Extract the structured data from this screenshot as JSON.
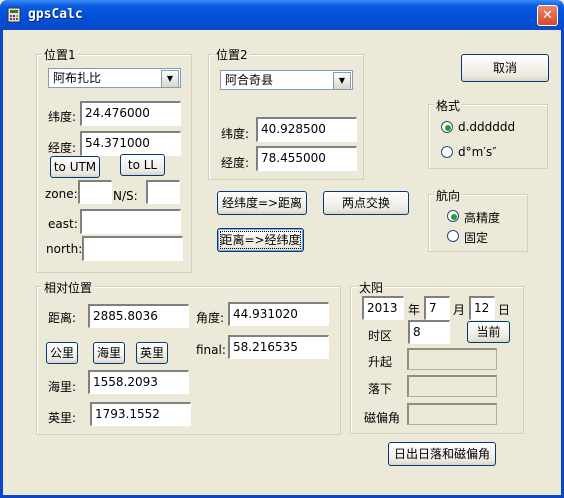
{
  "window": {
    "title": "gpsCalc",
    "close_glyph": "✕"
  },
  "pos1": {
    "group": "位置1",
    "place": "阿布扎比",
    "lat_label": "纬度:",
    "lat": "24.476000",
    "lon_label": "经度:",
    "lon": "54.371000",
    "to_utm": "to UTM",
    "to_ll": "to LL",
    "zone_label": "zone:",
    "ns_label": "N/S:",
    "east_label": "east:",
    "north_label": "north:"
  },
  "pos2": {
    "group": "位置2",
    "place": "阿合奇县",
    "lat_label": "纬度:",
    "lat": "40.928500",
    "lon_label": "经度:",
    "lon": "78.455000"
  },
  "buttons": {
    "cancel": "取消",
    "ll_to_dist": "经纬度=>距离",
    "swap": "两点交换",
    "dist_to_ll": "距离=>经纬度",
    "now": "当前",
    "sun_calc": "日出日落和磁偏角"
  },
  "format": {
    "group": "格式",
    "opt1": "d.dddddd",
    "opt2": "d°m′s″",
    "selected": "opt1"
  },
  "heading": {
    "group": "航向",
    "opt1": "高精度",
    "opt2": "固定",
    "selected": "opt1"
  },
  "relative": {
    "group": "相对位置",
    "dist_label": "距离:",
    "dist": "2885.8036",
    "angle_label": "角度:",
    "angle": "44.931020",
    "km": "公里",
    "nmi": "海里",
    "mi": "英里",
    "final_label": "final:",
    "final": "58.216535",
    "nmi_label": "海里:",
    "nmi_value": "1558.2093",
    "mi_label": "英里:",
    "mi_value": "1793.1552"
  },
  "sun": {
    "group": "太阳",
    "year": "2013",
    "year_label": "年",
    "month": "7",
    "month_label": "月",
    "day": "12",
    "day_label": "日",
    "tz_label": "时区",
    "tz": "8",
    "rise_label": "升起",
    "set_label": "落下",
    "decl_label": "磁偏角"
  },
  "colors": {
    "window_bg": "#ece9d8",
    "titlebar": "#0050d8",
    "close": "#d4472b"
  }
}
